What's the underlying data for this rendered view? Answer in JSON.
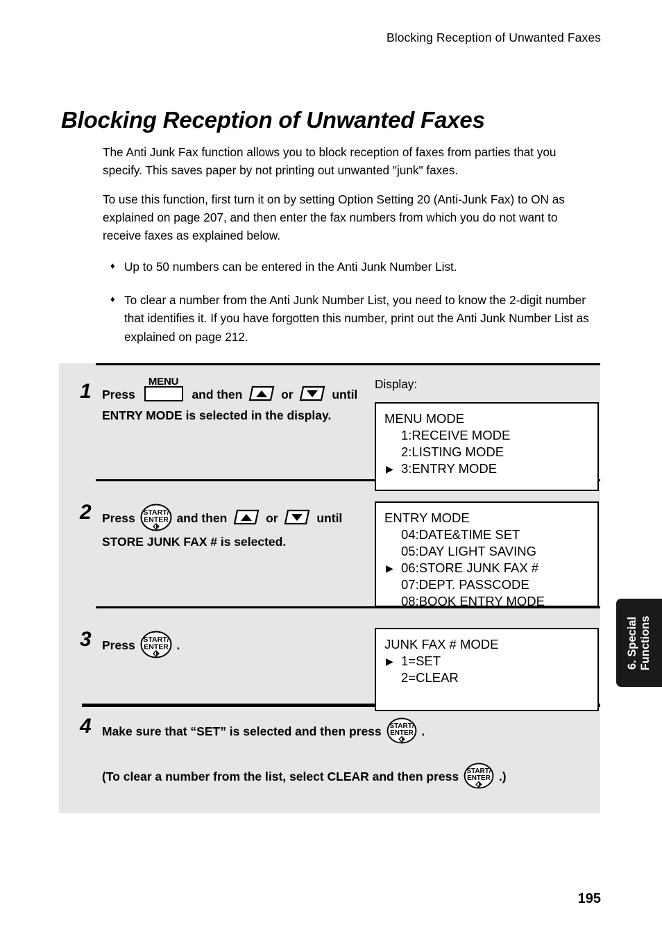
{
  "header": {
    "running_title": "Blocking Reception of Unwanted Faxes"
  },
  "title": "Blocking Reception of Unwanted Faxes",
  "intro": {
    "para1": "The Anti Junk Fax function allows you to block reception of faxes from parties that you specify. This saves paper by not printing out unwanted \"junk\" faxes.",
    "para2": "To use this function, first turn it on by setting Option Setting 20 (Anti-Junk Fax) to ON as explained on page 207, and then enter the fax numbers from which you do not want to receive faxes as explained below."
  },
  "bullets": [
    {
      "glyph": "♦",
      "text": "Up to 50 numbers can be entered in the Anti Junk Number List."
    },
    {
      "glyph": "♦",
      "text": "To clear a number from the Anti Junk Number List, you need to know the 2-digit number that identifies it. If you have forgotten this number, print out the Anti Junk Number List as explained on page 212."
    }
  ],
  "procedure": {
    "display_label": "Display:",
    "steps": [
      {
        "number": "1",
        "text_before_menu": "Press",
        "menu_key_label": "MENU",
        "text_between": "and then",
        "or_label": "or",
        "text_after": "until ENTRY MODE is selected in the display.",
        "display": {
          "title": "MENU MODE",
          "lines": [
            {
              "marker": "",
              "text": "1:RECEIVE MODE"
            },
            {
              "marker": "",
              "text": "2:LISTING MODE"
            },
            {
              "marker": "▶",
              "text": "3:ENTRY MODE"
            }
          ]
        }
      },
      {
        "number": "2",
        "text_before": "Press",
        "start_key_label_top": "START/",
        "start_key_label_bottom": "ENTER",
        "text_between": "and then",
        "or_label": "or",
        "text_after": "until STORE JUNK FAX # is selected.",
        "display": {
          "title": "ENTRY MODE",
          "lines": [
            {
              "marker": "",
              "text": "04:DATE&TIME SET"
            },
            {
              "marker": "",
              "text": "05:DAY LIGHT SAVING"
            },
            {
              "marker": "▶",
              "text": "06:STORE JUNK FAX #"
            },
            {
              "marker": "",
              "text": "07:DEPT. PASSCODE"
            },
            {
              "marker": "",
              "text": "08:BOOK ENTRY MODE"
            }
          ]
        }
      },
      {
        "number": "3",
        "text_before": "Press",
        "text_after": ".",
        "display": {
          "title": "JUNK FAX # MODE",
          "lines": [
            {
              "marker": "▶",
              "text": "1=SET"
            },
            {
              "marker": "",
              "text": "2=CLEAR"
            }
          ]
        }
      },
      {
        "number": "4",
        "main_text_before": "Make sure that “SET” is selected and then press",
        "main_text_after": ".",
        "sub_text_before": "(To clear a number from the list, select CLEAR and then press",
        "sub_text_after": ".)"
      }
    ]
  },
  "side_tab": {
    "line1": "6. Special",
    "line2": "Functions"
  },
  "page_number": "195",
  "colors": {
    "panel_background": "#e6e6e6",
    "tab_background": "#1a1a1a",
    "ink": "#000000",
    "lcd_background": "#ffffff"
  }
}
